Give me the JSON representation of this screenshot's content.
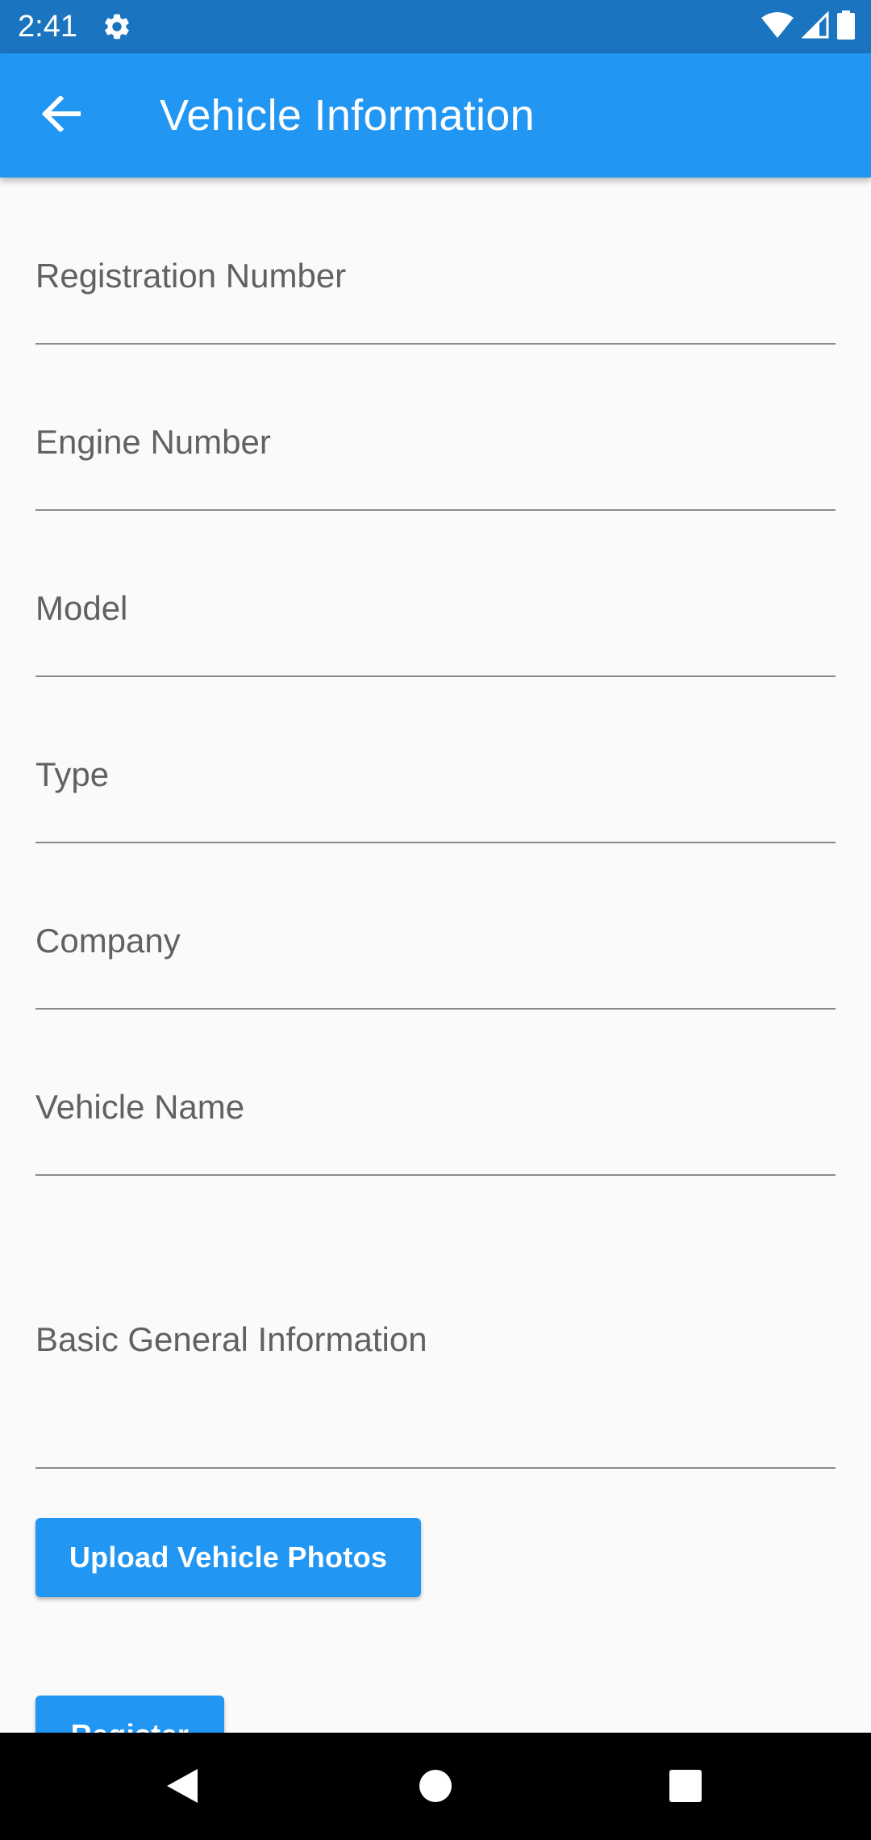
{
  "status_bar": {
    "time": "2:41",
    "icons": [
      "settings-gear-icon",
      "wifi-icon",
      "cell-signal-icon",
      "battery-icon"
    ],
    "background_color": "#1b74bf"
  },
  "app_bar": {
    "title": "Vehicle Information",
    "back_icon": "arrow-back-icon",
    "background_color": "#2196f3"
  },
  "form": {
    "fields": [
      {
        "label": "Registration Number",
        "value": ""
      },
      {
        "label": "Engine Number",
        "value": ""
      },
      {
        "label": "Model",
        "value": ""
      },
      {
        "label": "Type",
        "value": ""
      },
      {
        "label": "Company",
        "value": ""
      },
      {
        "label": "Vehicle Name",
        "value": ""
      },
      {
        "label": "Basic General Information",
        "value": ""
      }
    ],
    "upload_button_label": "Upload Vehicle Photos",
    "register_button_label": "Register"
  },
  "nav_bar": {
    "buttons": [
      "back-triangle-icon",
      "home-circle-icon",
      "recents-square-icon"
    ]
  },
  "colors": {
    "accent": "#2196f3",
    "label_text": "#616161",
    "underline": "#8a8a8a",
    "background": "#fafafa"
  }
}
